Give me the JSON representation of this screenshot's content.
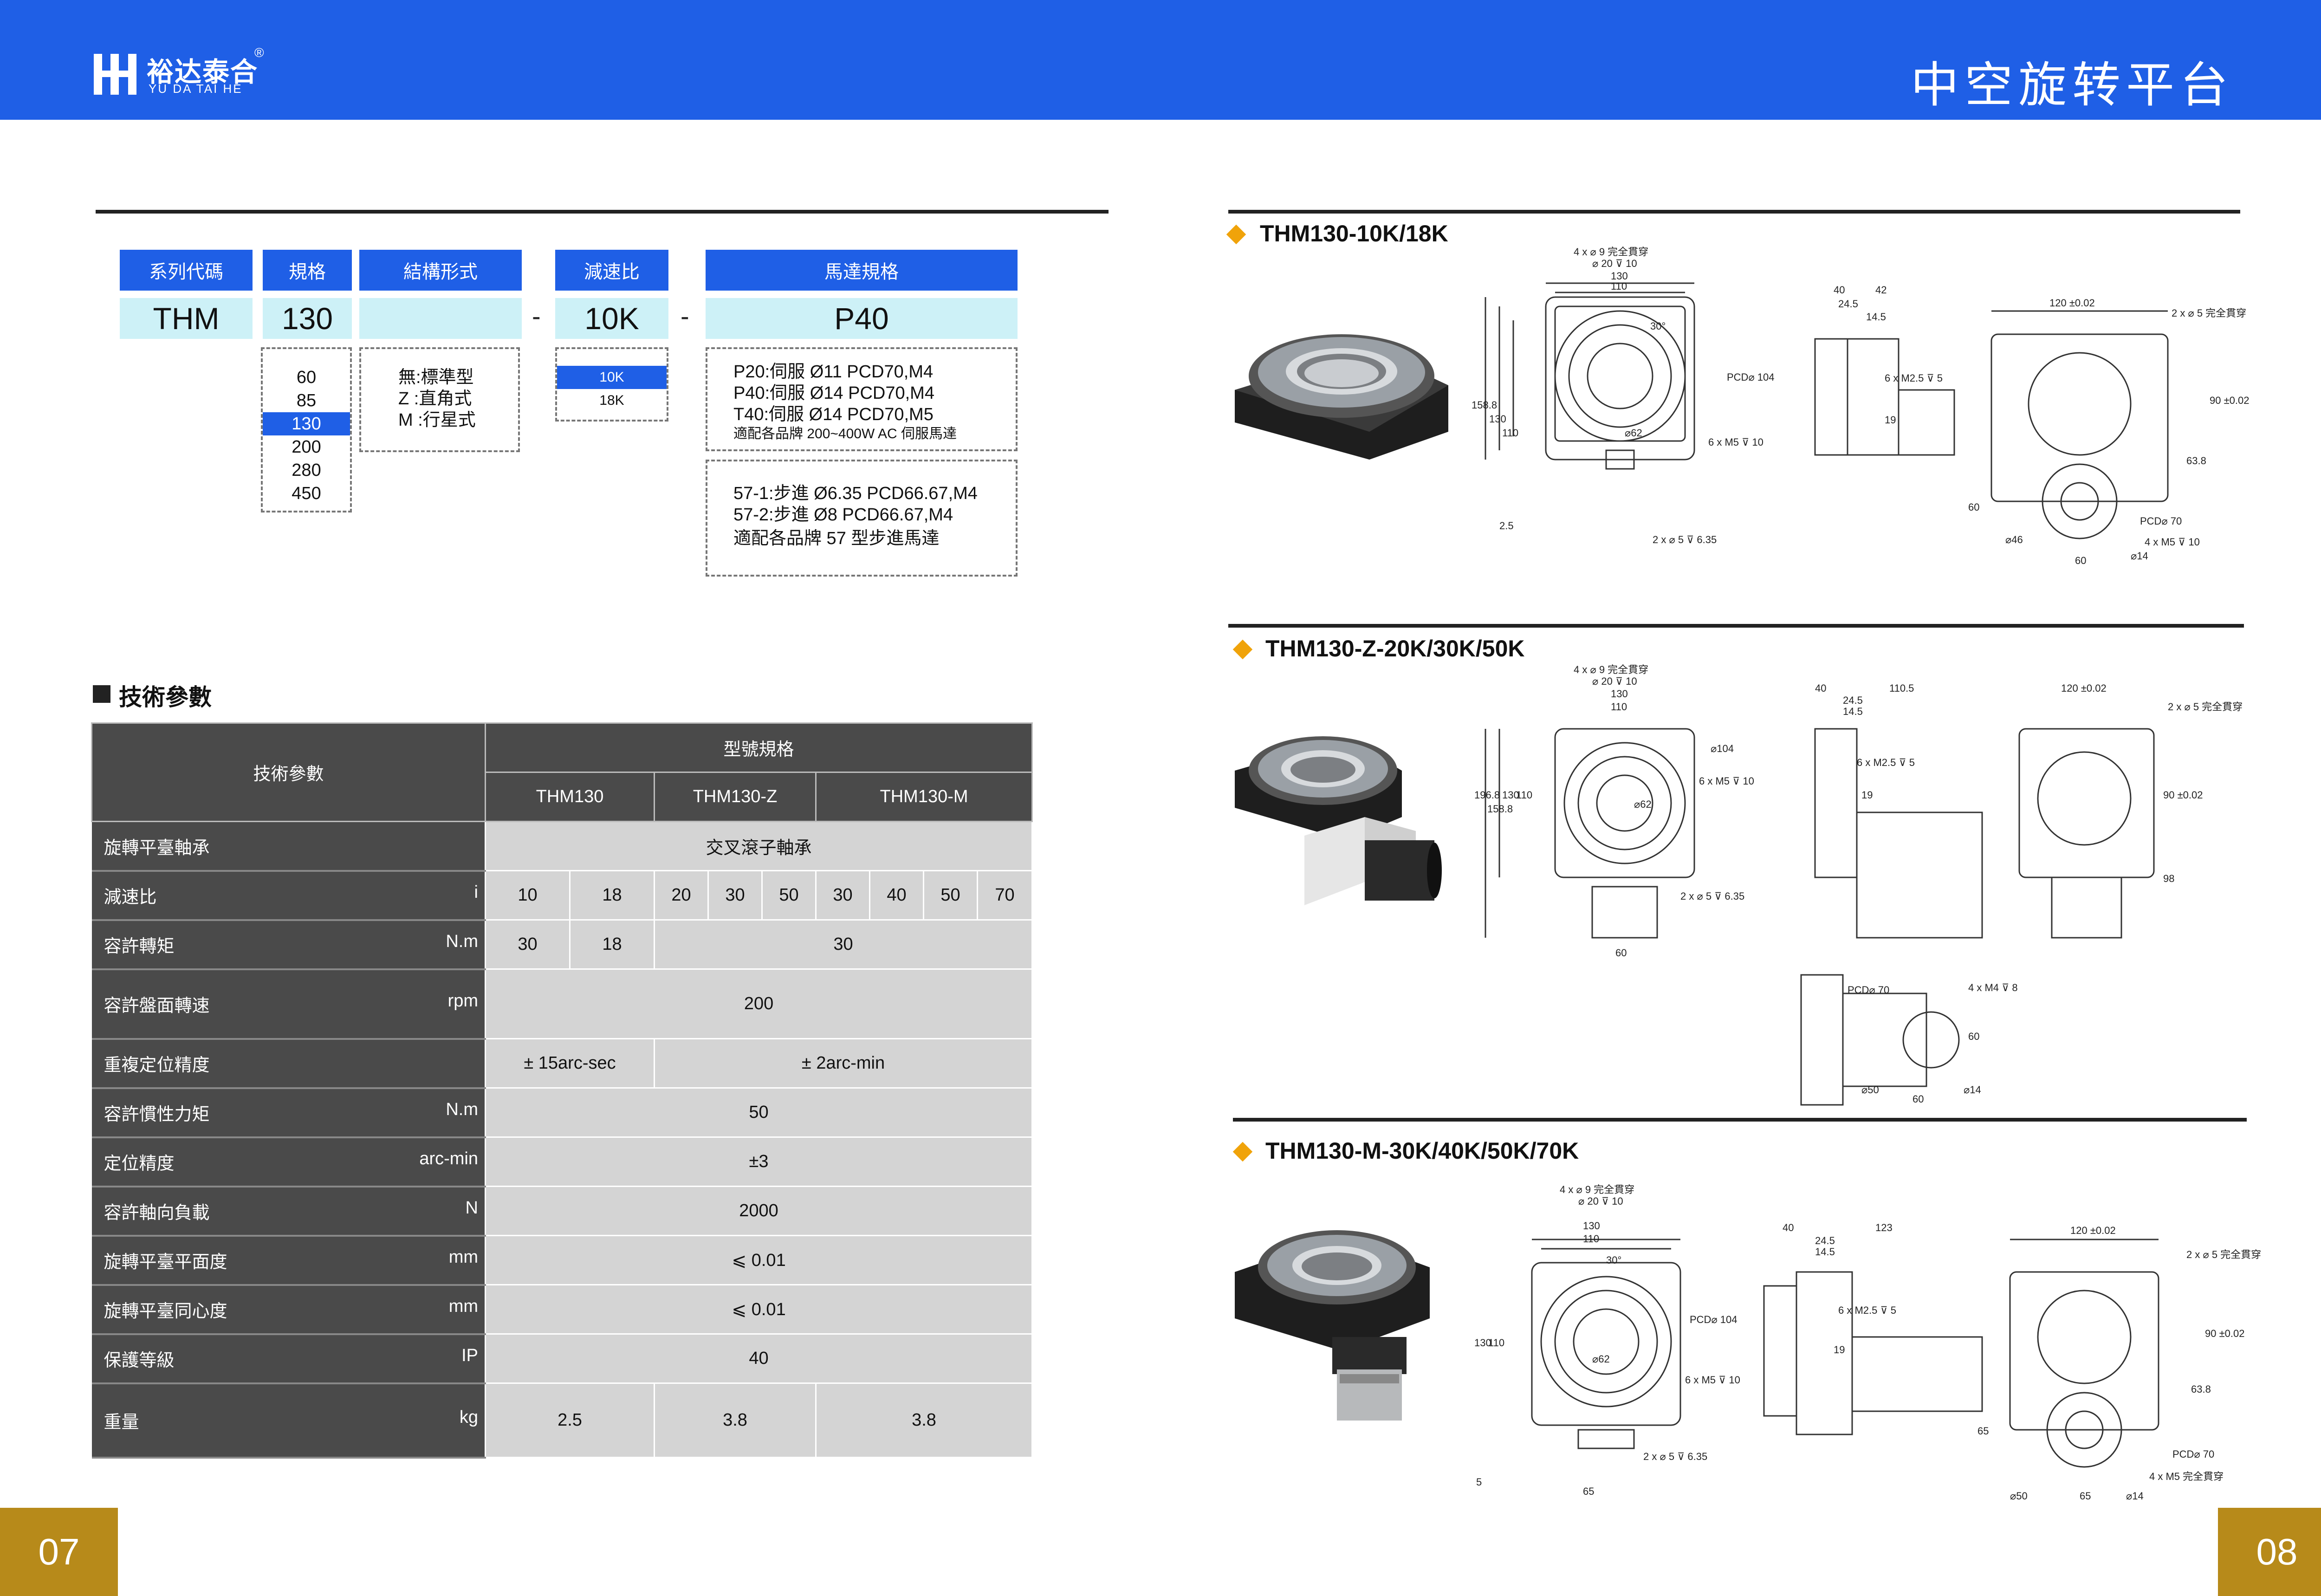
{
  "header": {
    "logo_cn": "裕达泰合",
    "logo_en": "YU DA TAI HE",
    "logo_reg": "®",
    "title": "中空旋转平台"
  },
  "pages": {
    "left": "07",
    "right": "08"
  },
  "model_code": {
    "headers": [
      "系列代碼",
      "規格",
      "結構形式",
      "減速比",
      "馬達規格"
    ],
    "values": [
      "THM",
      "130",
      "",
      "10K",
      "P40"
    ],
    "dash": "-",
    "size_options": [
      "60",
      "85",
      "130",
      "200",
      "280",
      "450"
    ],
    "size_selected": "130",
    "structure_options": [
      "無:標準型",
      "Z :直角式",
      "M :行星式"
    ],
    "ratio_options": [
      "10K",
      "18K"
    ],
    "ratio_selected": "10K",
    "motor_servo": [
      "P20:伺服 Ø11 PCD70,M4",
      "P40:伺服 Ø14 PCD70,M4",
      "T40:伺服 Ø14 PCD70,M5",
      "適配各品牌 200~400W AC 伺服馬達"
    ],
    "motor_stepper": [
      "57-1:步進 Ø6.35 PCD66.67,M4",
      "57-2:步進 Ø8 PCD66.67,M4",
      "適配各品牌 57 型步進馬達"
    ]
  },
  "spec": {
    "title": "技術參數",
    "header_param": "技術參數",
    "header_model": "型號規格",
    "models": [
      "THM130",
      "THM130-Z",
      "THM130-M"
    ],
    "rows": [
      {
        "label": "旋轉平臺軸承",
        "unit": "",
        "text": "交叉滾子軸承"
      },
      {
        "label": "減速比",
        "unit": "i",
        "values": [
          "10",
          "18",
          "20",
          "30",
          "50",
          "30",
          "40",
          "50",
          "70"
        ]
      },
      {
        "label": "容許轉矩",
        "unit": "N.m",
        "values": [
          "30",
          "18",
          "30"
        ]
      },
      {
        "label": "容許盤面轉速",
        "unit": "rpm",
        "text": "200"
      },
      {
        "label": "重複定位精度",
        "unit": "",
        "values": [
          "± 15arc-sec",
          "± 2arc-min"
        ]
      },
      {
        "label": "容許慣性力矩",
        "unit": "N.m",
        "text": "50"
      },
      {
        "label": "定位精度",
        "unit": "arc-min",
        "text": "±3"
      },
      {
        "label": "容許軸向負載",
        "unit": "N",
        "text": "2000"
      },
      {
        "label": "旋轉平臺平面度",
        "unit": "mm",
        "text": "⩽ 0.01"
      },
      {
        "label": "旋轉平臺同心度",
        "unit": "mm",
        "text": "⩽ 0.01"
      },
      {
        "label": "保護等級",
        "unit": "IP",
        "text": "40"
      },
      {
        "label": "重量",
        "unit": "kg",
        "values": [
          "2.5",
          "3.8",
          "3.8"
        ]
      }
    ]
  },
  "drawings": [
    {
      "title": "THM130-10K/18K",
      "top_labels": [
        "4 x  ⌀ 9 完全貫穿",
        "⌀ 20 ⊽ 10",
        "130",
        "110",
        "30°"
      ],
      "front_labels": [
        "PCD⌀ 104",
        "⌀62",
        "6 x M5 ⊽ 10",
        "2 x  ⌀ 5 ⊽ 6.35",
        "158.8",
        "130",
        "110",
        "2.5"
      ],
      "side_labels": [
        "40",
        "42",
        "24.5",
        "14.5",
        "6 x M2.5 ⊽ 5",
        "19"
      ],
      "rear_labels": [
        "120 ±0.02",
        "2 x  ⌀ 5 完全貫穿",
        "90 ±0.02",
        "63.8",
        "60",
        "PCD⌀ 70",
        "⌀46",
        "4 x M5 ⊽ 10",
        "60",
        "⌀14"
      ]
    },
    {
      "title": "THM130-Z-20K/30K/50K",
      "top_labels": [
        "4 x  ⌀ 9 完全貫穿",
        "⌀ 20 ⊽ 10",
        "130",
        "110"
      ],
      "front_labels": [
        "⌀104",
        "6 x M5 ⊽ 10",
        "⌀62",
        "2 x  ⌀ 5 ⊽ 6.35",
        "196.8",
        "158.8",
        "130",
        "110",
        "60"
      ],
      "side_labels": [
        "40",
        "110.5",
        "24.5",
        "14.5",
        "6 x M2.5 ⊽ 5",
        "19"
      ],
      "rear_labels": [
        "120 ±0.02",
        "2 x  ⌀ 5 完全貫穿",
        "90 ±0.02",
        "98"
      ],
      "flange_labels": [
        "PCD⌀ 70",
        "4 x M4 ⊽ 8",
        "60",
        "⌀50",
        "60",
        "⌀14"
      ]
    },
    {
      "title": "THM130-M-30K/40K/50K/70K",
      "top_labels": [
        "4 x  ⌀ 9 完全貫穿",
        "⌀ 20 ⊽ 10",
        "130",
        "110",
        "30°"
      ],
      "front_labels": [
        "PCD⌀ 104",
        "⌀62",
        "6 x M5 ⊽ 10",
        "2 x  ⌀ 5 ⊽ 6.35",
        "130",
        "110",
        "5",
        "65"
      ],
      "side_labels": [
        "40",
        "123",
        "24.5",
        "14.5",
        "6 x M2.5 ⊽ 5",
        "19"
      ],
      "rear_labels": [
        "120 ±0.02",
        "2 x  ⌀ 5 完全貫穿",
        "90 ±0.02",
        "63.8",
        "65",
        "PCD⌀ 70",
        "4 x M5 完全貫穿",
        "⌀50",
        "65",
        "⌀14"
      ]
    }
  ]
}
